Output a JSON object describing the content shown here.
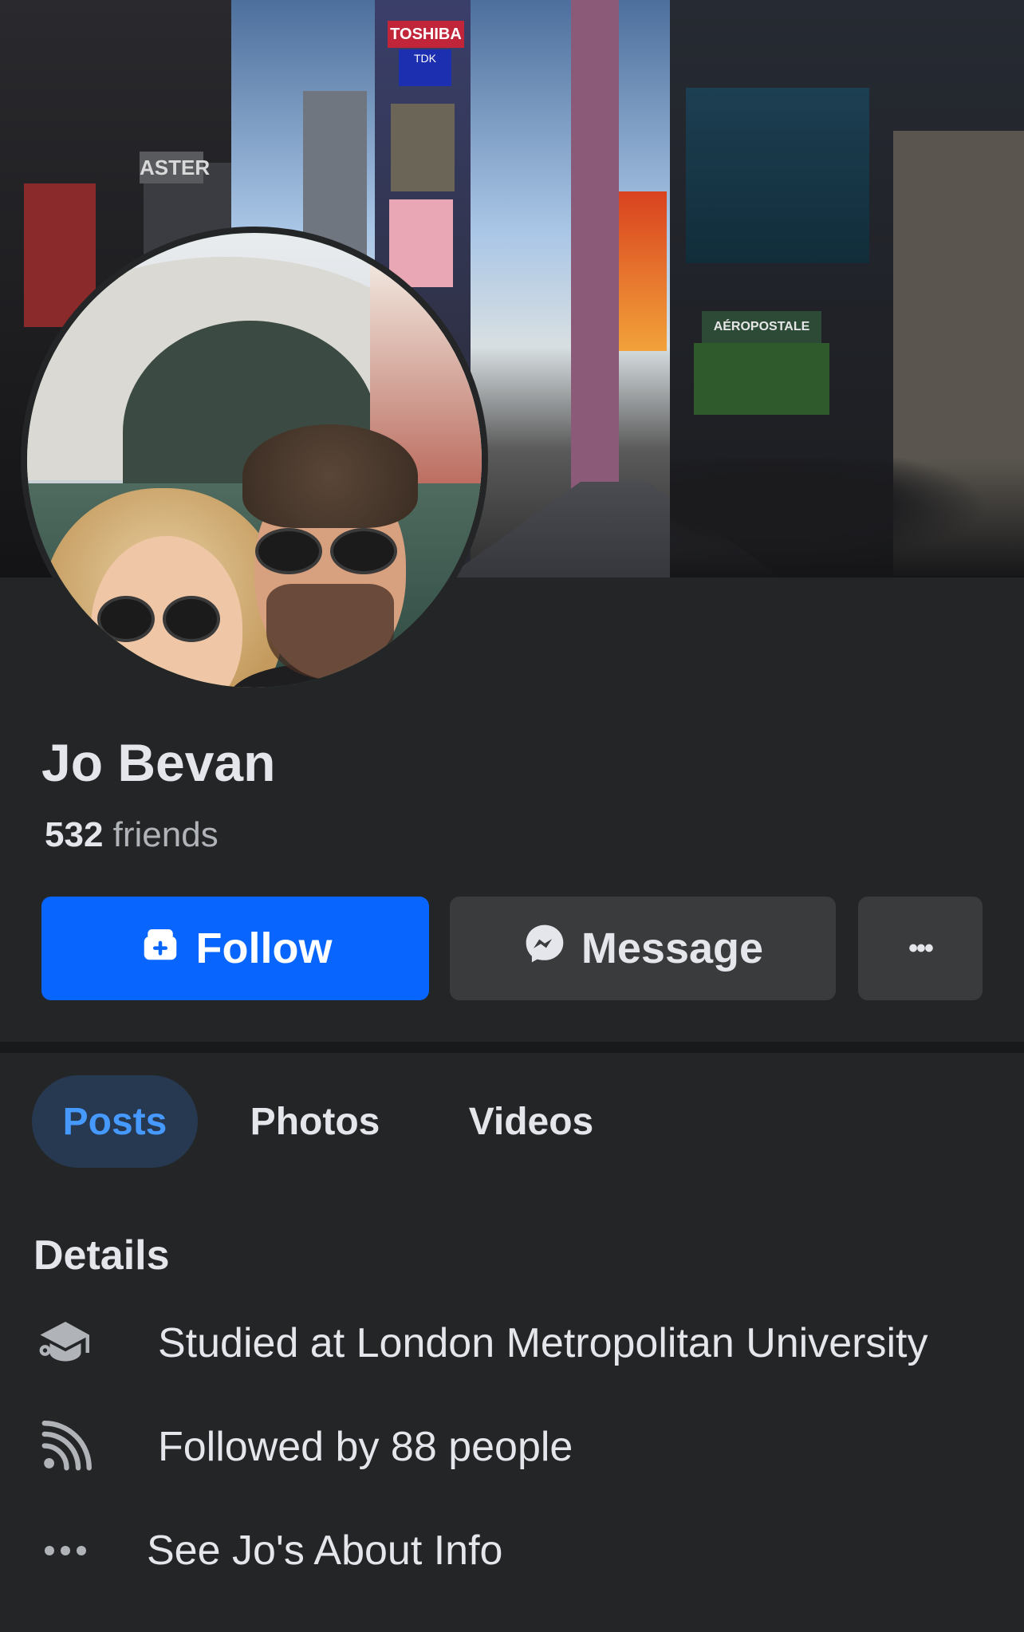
{
  "profile": {
    "name": "Jo Bevan",
    "friends_count": "532",
    "friends_label": "friends"
  },
  "actions": {
    "follow_label": "Follow",
    "message_label": "Message",
    "more_label": "•••"
  },
  "tabs": [
    {
      "label": "Posts",
      "active": true
    },
    {
      "label": "Photos",
      "active": false
    },
    {
      "label": "Videos",
      "active": false
    }
  ],
  "details": {
    "title": "Details",
    "items": [
      {
        "icon": "graduation-cap-icon",
        "text": "Studied at London Metropolitan University"
      },
      {
        "icon": "rss-feed-icon",
        "text": "Followed by 88 people"
      },
      {
        "icon": "ellipsis-icon",
        "text": "See Jo's About Info"
      }
    ]
  },
  "cover_signs": {
    "toshiba": "TOSHIBA",
    "tdk": "TDK",
    "aster": "ASTER",
    "aeropostale": "AÉROPOSTALE"
  },
  "colors": {
    "background": "#242526",
    "primary": "#0866ff",
    "secondary_button": "#3a3b3c",
    "active_tab_bg": "#263951",
    "active_tab_text": "#4599ff",
    "text_primary": "#e4e6eb",
    "text_secondary": "#b0b3b8"
  }
}
